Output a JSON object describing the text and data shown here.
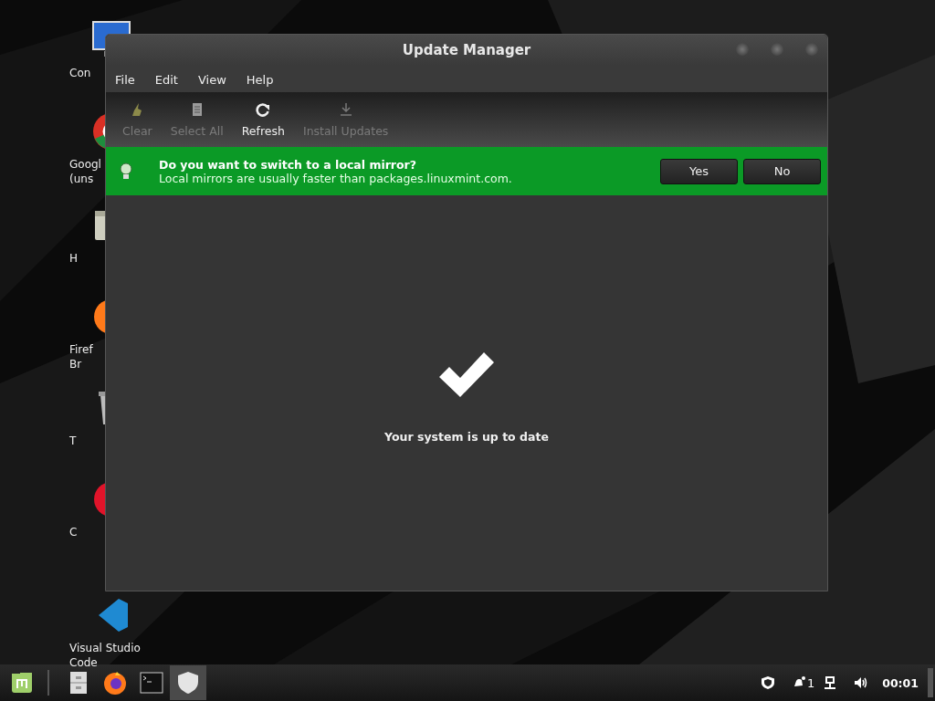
{
  "desktop_icons": [
    {
      "kind": "monitor",
      "label_lines": [
        "Con"
      ]
    },
    {
      "kind": "chrome",
      "label_lines": [
        "Googl",
        "(uns"
      ]
    },
    {
      "kind": "folder",
      "label_lines": [
        "H"
      ]
    },
    {
      "kind": "firefox",
      "label_lines": [
        "Firef",
        "Br"
      ]
    },
    {
      "kind": "trash",
      "label_lines": [
        "T"
      ]
    },
    {
      "kind": "opera",
      "label_lines": [
        "C"
      ]
    },
    {
      "kind": "vscode",
      "label_lines": [
        "Visual Studio",
        "Code"
      ]
    }
  ],
  "window": {
    "title": "Update Manager",
    "menu": [
      "File",
      "Edit",
      "View",
      "Help"
    ],
    "toolbar": [
      {
        "kind": "clear",
        "label": "Clear",
        "disabled": true
      },
      {
        "kind": "select",
        "label": "Select All",
        "disabled": true
      },
      {
        "kind": "refresh",
        "label": "Refresh",
        "disabled": false
      },
      {
        "kind": "install",
        "label": "Install Updates",
        "disabled": true
      }
    ],
    "infobar": {
      "title": "Do you want to switch to a local mirror?",
      "message": "Local mirrors are usually faster than packages.linuxmint.com.",
      "buttons": [
        "Yes",
        "No"
      ]
    },
    "status": "Your system is up to date"
  },
  "taskbar": {
    "launchers": [
      {
        "kind": "menu",
        "selected": false
      },
      {
        "kind": "files",
        "selected": false
      },
      {
        "kind": "firefox",
        "selected": false
      },
      {
        "kind": "terminal",
        "selected": false
      },
      {
        "kind": "shield",
        "selected": true
      }
    ],
    "tray": [
      {
        "kind": "shield"
      },
      {
        "kind": "notifications",
        "text": "1"
      },
      {
        "kind": "network"
      },
      {
        "kind": "volume"
      }
    ],
    "clock": "00:01"
  }
}
